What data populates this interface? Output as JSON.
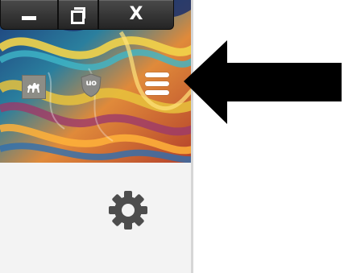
{
  "window": {
    "caption_buttons": {
      "minimize_icon": "minimize-icon",
      "maximize_icon": "restore-icon",
      "close_icon": "close-icon",
      "close_glyph": "X"
    }
  },
  "toolbar": {
    "extensions": [
      {
        "name": "camel-extension",
        "icon": "camel-icon"
      },
      {
        "name": "ublock-extension",
        "icon": "ublock-shield-icon",
        "label": "uo"
      }
    ],
    "menu_icon": "hamburger-menu-icon"
  },
  "panel": {
    "settings_icon": "gear-icon"
  },
  "annotation": {
    "arrow_icon": "pointer-arrow-icon",
    "arrow_color": "#000000"
  },
  "colors": {
    "caption_button": "#2f2f2f",
    "panel_background": "#f3f3f3",
    "gear": "#4d4d4d"
  }
}
